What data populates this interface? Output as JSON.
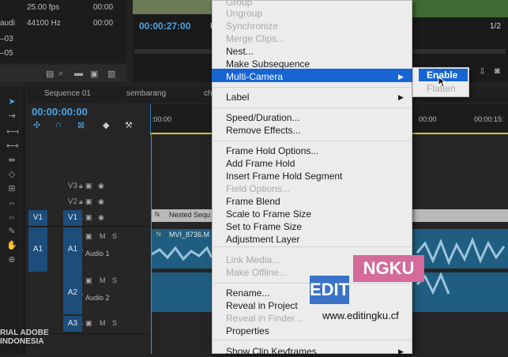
{
  "project_info": {
    "fps": "25.00 fps",
    "fps_time": "00:00",
    "audio_label": "audi",
    "hz": "44100 Hz",
    "hz_time": "00:00",
    "row3": "–03",
    "row4": "–05"
  },
  "program": {
    "timecode": "00:00:27:00",
    "ratio": "1/2",
    "fit_marker": "F"
  },
  "timeline": {
    "tabs": [
      "Sequence 01",
      "sembarang",
      "ch"
    ],
    "timecode": "00:00:00:00",
    "ruler_start": ":00:00",
    "ruler_mid": "00:00",
    "ruler_end": "00:00:15:"
  },
  "tracks": {
    "v3": "V3",
    "v2": "V2",
    "v1_src": "V1",
    "v1": "V1",
    "a1_src": "A1",
    "a1": "A1",
    "a1_name": "Audio 1",
    "a2": "A2",
    "a2_name": "Audio 2",
    "a3": "A3",
    "m": "M",
    "s": "S"
  },
  "clips": {
    "nested": "Nested Sequ",
    "audio": "MVI_8736.M"
  },
  "menu": {
    "items": [
      {
        "label": "Group",
        "disabled": true
      },
      {
        "label": "Ungroup",
        "disabled": true
      },
      {
        "label": "Synchronize",
        "disabled": true
      },
      {
        "label": "Merge Clips...",
        "disabled": true
      },
      {
        "label": "Nest...",
        "disabled": false
      },
      {
        "label": "Make Subsequence",
        "disabled": false
      },
      {
        "label": "Multi-Camera",
        "disabled": false,
        "highlighted": true,
        "submenu": true
      },
      {
        "label": "Label",
        "disabled": false,
        "submenu": true
      },
      {
        "label": "Speed/Duration...",
        "disabled": false
      },
      {
        "label": "Remove Effects...",
        "disabled": false
      },
      {
        "label": "Frame Hold Options...",
        "disabled": false
      },
      {
        "label": "Add Frame Hold",
        "disabled": false
      },
      {
        "label": "Insert Frame Hold Segment",
        "disabled": false
      },
      {
        "label": "Field Options...",
        "disabled": true
      },
      {
        "label": "Frame Blend",
        "disabled": false
      },
      {
        "label": "Scale to Frame Size",
        "disabled": false
      },
      {
        "label": "Set to Frame Size",
        "disabled": false
      },
      {
        "label": "Adjustment Layer",
        "disabled": false
      },
      {
        "label": "Link Media...",
        "disabled": true
      },
      {
        "label": "Make Offline...",
        "disabled": true
      },
      {
        "label": "Rename...",
        "disabled": false
      },
      {
        "label": "Reveal in Project",
        "disabled": false
      },
      {
        "label": "Reveal in Finder...",
        "disabled": true
      },
      {
        "label": "Properties",
        "disabled": false
      },
      {
        "label": "Show Clip Keyframes",
        "disabled": false,
        "submenu": true
      }
    ]
  },
  "submenu": {
    "enable": "Enable",
    "flatten": "Flatten"
  },
  "watermark": {
    "edit": "EDIT",
    "ngku": "NGKU",
    "url": "www.editingku.cf",
    "adobe_line1": "RIAL ADOBE",
    "adobe_line2": "INDONESIA"
  },
  "colors": {
    "highlight": "#1765d3",
    "timecode": "#4fa3e0",
    "track_active": "#1d4d7a"
  }
}
